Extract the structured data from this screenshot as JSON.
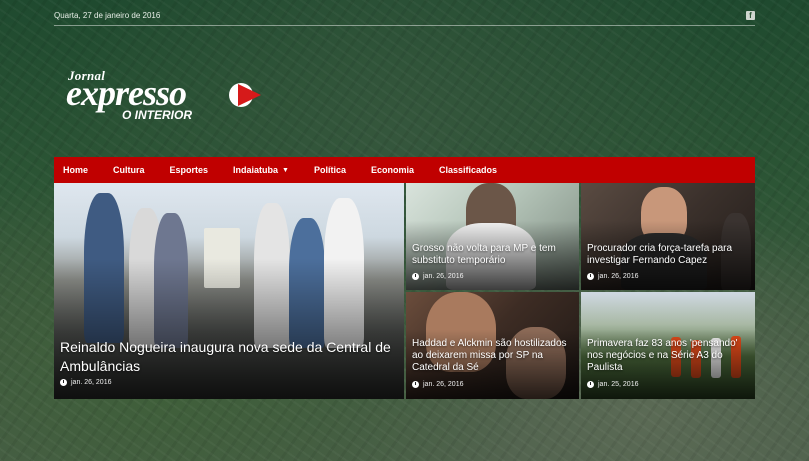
{
  "topbar": {
    "date": "Quarta, 27 de janeiro de 2016",
    "social_icon": "facebook-icon"
  },
  "logo": {
    "small": "Jornal",
    "big": "expresso",
    "sub": "O INTERIOR"
  },
  "nav": {
    "items": [
      {
        "label": "Home"
      },
      {
        "label": "Cultura"
      },
      {
        "label": "Esportes"
      },
      {
        "label": "Indaiatuba",
        "has_dropdown": true
      },
      {
        "label": "Política"
      },
      {
        "label": "Economia"
      },
      {
        "label": "Classificados"
      }
    ]
  },
  "colors": {
    "accent": "#c00000",
    "overlay": "#2c5535"
  },
  "articles": [
    {
      "title": "Reinaldo Nogueira inaugura nova sede da Central de Ambulâncias",
      "date": "jan. 26, 2016"
    },
    {
      "title": "Grosso não volta para MP e tem substituto temporário",
      "date": "jan. 26, 2016"
    },
    {
      "title": "Procurador cria força-tarefa para investigar Fernando Capez",
      "date": "jan. 26, 2016"
    },
    {
      "title": "Haddad e Alckmin são hostilizados ao deixarem missa por SP na Catedral da Sé",
      "date": "jan. 26, 2016"
    },
    {
      "title": "Primavera faz 83 anos 'pensando' nos negócios e na Série A3 do Paulista",
      "date": "jan. 25, 2016"
    }
  ]
}
